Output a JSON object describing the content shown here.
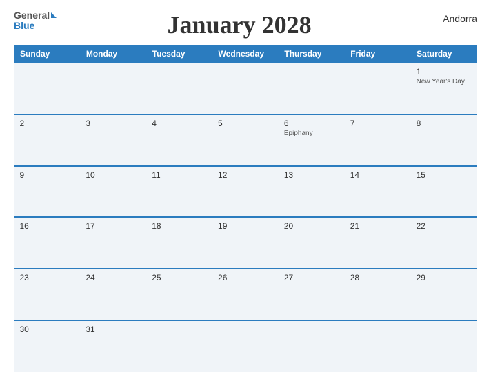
{
  "header": {
    "logo": {
      "general": "General",
      "blue": "Blue"
    },
    "title": "January 2028",
    "region": "Andorra"
  },
  "calendar": {
    "days_of_week": [
      "Sunday",
      "Monday",
      "Tuesday",
      "Wednesday",
      "Thursday",
      "Friday",
      "Saturday"
    ],
    "weeks": [
      [
        {
          "day": "",
          "holiday": ""
        },
        {
          "day": "",
          "holiday": ""
        },
        {
          "day": "",
          "holiday": ""
        },
        {
          "day": "",
          "holiday": ""
        },
        {
          "day": "",
          "holiday": ""
        },
        {
          "day": "",
          "holiday": ""
        },
        {
          "day": "1",
          "holiday": "New Year's Day"
        }
      ],
      [
        {
          "day": "2",
          "holiday": ""
        },
        {
          "day": "3",
          "holiday": ""
        },
        {
          "day": "4",
          "holiday": ""
        },
        {
          "day": "5",
          "holiday": ""
        },
        {
          "day": "6",
          "holiday": "Epiphany"
        },
        {
          "day": "7",
          "holiday": ""
        },
        {
          "day": "8",
          "holiday": ""
        }
      ],
      [
        {
          "day": "9",
          "holiday": ""
        },
        {
          "day": "10",
          "holiday": ""
        },
        {
          "day": "11",
          "holiday": ""
        },
        {
          "day": "12",
          "holiday": ""
        },
        {
          "day": "13",
          "holiday": ""
        },
        {
          "day": "14",
          "holiday": ""
        },
        {
          "day": "15",
          "holiday": ""
        }
      ],
      [
        {
          "day": "16",
          "holiday": ""
        },
        {
          "day": "17",
          "holiday": ""
        },
        {
          "day": "18",
          "holiday": ""
        },
        {
          "day": "19",
          "holiday": ""
        },
        {
          "day": "20",
          "holiday": ""
        },
        {
          "day": "21",
          "holiday": ""
        },
        {
          "day": "22",
          "holiday": ""
        }
      ],
      [
        {
          "day": "23",
          "holiday": ""
        },
        {
          "day": "24",
          "holiday": ""
        },
        {
          "day": "25",
          "holiday": ""
        },
        {
          "day": "26",
          "holiday": ""
        },
        {
          "day": "27",
          "holiday": ""
        },
        {
          "day": "28",
          "holiday": ""
        },
        {
          "day": "29",
          "holiday": ""
        }
      ],
      [
        {
          "day": "30",
          "holiday": ""
        },
        {
          "day": "31",
          "holiday": ""
        },
        {
          "day": "",
          "holiday": ""
        },
        {
          "day": "",
          "holiday": ""
        },
        {
          "day": "",
          "holiday": ""
        },
        {
          "day": "",
          "holiday": ""
        },
        {
          "day": "",
          "holiday": ""
        }
      ]
    ]
  }
}
